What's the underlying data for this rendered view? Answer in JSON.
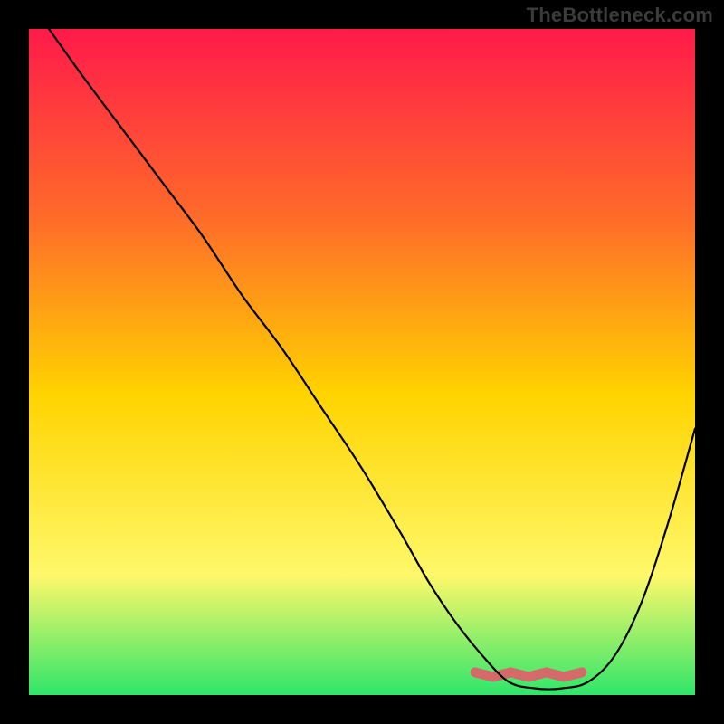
{
  "watermark": "TheBottleneck.com",
  "chart_data": {
    "type": "line",
    "title": "",
    "xlabel": "",
    "ylabel": "",
    "xlim": [
      0,
      100
    ],
    "ylim": [
      0,
      100
    ],
    "background_gradient": {
      "top": "#ff1a4a",
      "mid_upper": "#ff6a2a",
      "mid": "#ffd400",
      "mid_lower": "#fff86a",
      "bottom": "#2fe66a"
    },
    "series": [
      {
        "name": "bottleneck-curve",
        "color": "#000000",
        "x": [
          3,
          8,
          14,
          20,
          26,
          32,
          38,
          44,
          50,
          56,
          60,
          64,
          68,
          72,
          76,
          80,
          84,
          88,
          92,
          96,
          100
        ],
        "values": [
          100,
          93,
          85,
          77,
          69,
          60,
          52,
          43,
          34,
          24,
          17,
          11,
          6,
          2,
          1,
          1,
          2,
          6,
          14,
          26,
          40
        ]
      }
    ],
    "annotations": [
      {
        "name": "valley-highlight",
        "type": "segment",
        "color": "#d46a6a",
        "x_start": 67,
        "x_end": 83,
        "y_start": 3,
        "y_end": 3
      }
    ]
  }
}
